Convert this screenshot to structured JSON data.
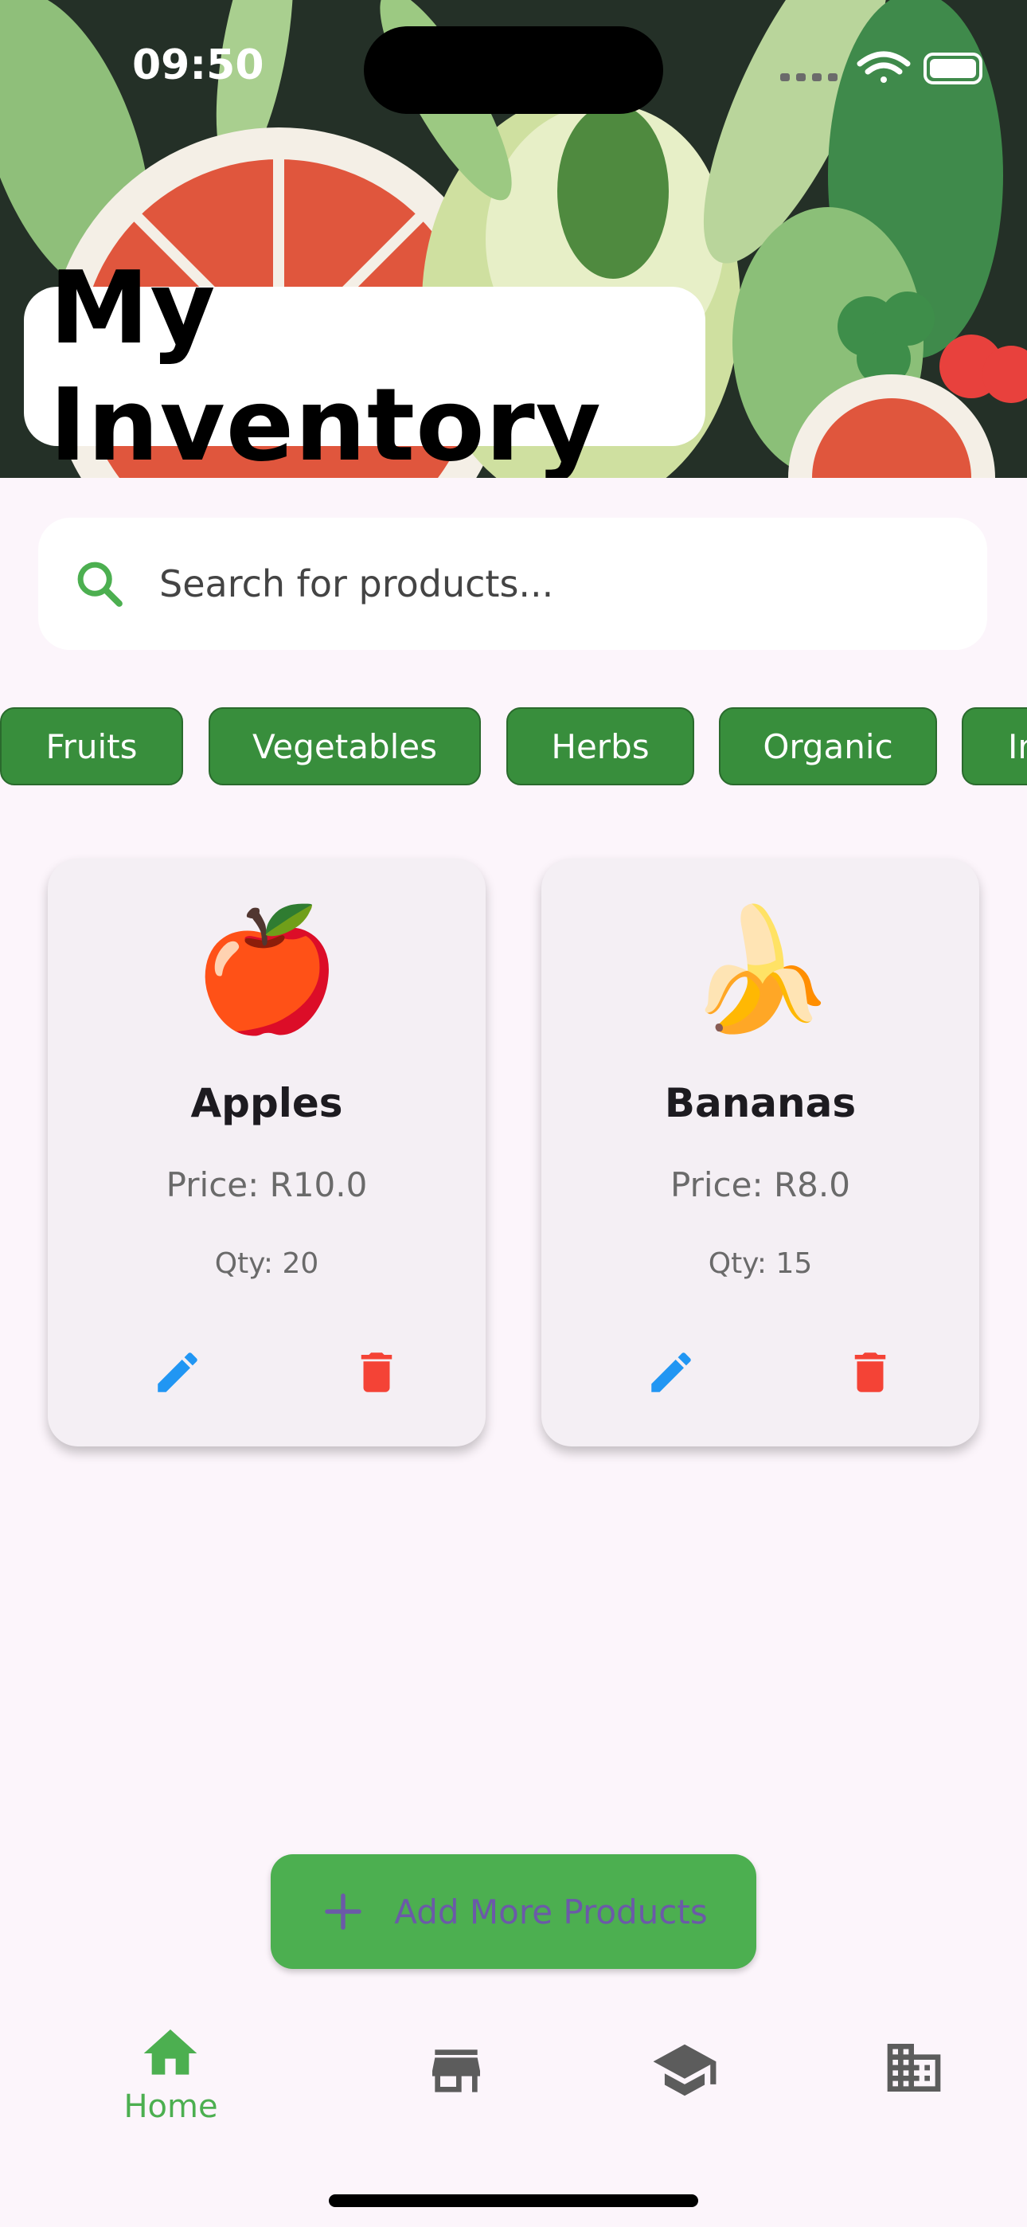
{
  "status_bar": {
    "time": "09:50"
  },
  "header": {
    "title": "My Inventory"
  },
  "search": {
    "placeholder": "Search for products..."
  },
  "categories": [
    "Fruits",
    "Vegetables",
    "Herbs",
    "Organic",
    "In"
  ],
  "products": [
    {
      "emoji": "🍎",
      "name": "Apples",
      "price": "Price: R10.0",
      "qty": "Qty: 20"
    },
    {
      "emoji": "🍌",
      "name": "Bananas",
      "price": "Price: R8.0",
      "qty": "Qty: 15"
    }
  ],
  "actions": {
    "add_label": "Add More Products"
  },
  "bottom_nav": {
    "home_label": "Home",
    "icons": [
      "home-icon",
      "store-icon",
      "school-icon",
      "business-icon"
    ]
  },
  "colors": {
    "accent": "#4caf50",
    "chip": "#388e3c",
    "edit": "#2196f3",
    "delete": "#f44336",
    "background": "#fcf5fb"
  }
}
